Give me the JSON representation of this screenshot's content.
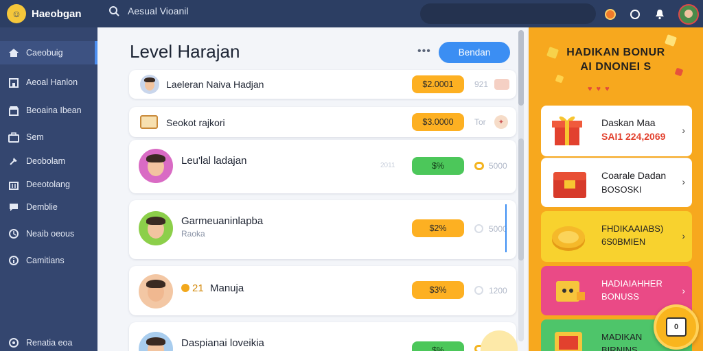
{
  "app": {
    "name": "Haeobgan",
    "search_text": "Aesual Vioanil"
  },
  "sidebar": {
    "items": [
      {
        "label": "Caeobuig",
        "icon": "home-icon"
      },
      {
        "label": "Aeoal Hanlon",
        "icon": "building-icon"
      },
      {
        "label": "Beoaina Ibean",
        "icon": "store-icon"
      },
      {
        "label": "Sem",
        "icon": "briefcase-icon"
      },
      {
        "label": "Deobolam",
        "icon": "pin-icon"
      },
      {
        "label": "Deeotolang",
        "icon": "bank-icon"
      },
      {
        "label": "Demblie",
        "icon": "chat-icon"
      },
      {
        "label": "Neaib oeous",
        "icon": "clock-icon"
      },
      {
        "label": "Camitians",
        "icon": "info-icon"
      },
      {
        "label": "Renatia eoa",
        "icon": "settings-icon"
      }
    ]
  },
  "main": {
    "title": "Level Harajan",
    "more_label": "•••",
    "primary_button": "Bendan",
    "rows": [
      {
        "name": "Laeleran Naiva Hadjan",
        "amount": "$2.0001",
        "side_value": "921",
        "pill": "yellow"
      },
      {
        "name": "Seokot rajkori",
        "amount": "$3.0000",
        "side_value": "Tor",
        "pill": "yellow"
      },
      {
        "name": "Leu'lal ladajan",
        "amount": "$%",
        "side_value": "5000",
        "pill": "green",
        "side_label": "2011"
      },
      {
        "name": "Garmeuaninlapba",
        "subtitle": "Raoka",
        "amount": "$2%",
        "side_value": "5000",
        "pill": "yellow"
      },
      {
        "name": "Manuja",
        "badge": "21",
        "amount": "$3%",
        "side_value": "1200",
        "pill": "yellow"
      },
      {
        "name": "Daspianai loveikia",
        "amount": "$%",
        "pill": "green"
      }
    ]
  },
  "promo_panel": {
    "title_line1": "HADIKAN BONUR",
    "title_line2": "AI DNONEI S",
    "cards": [
      {
        "line1": "Daskan Maa",
        "line2": "SAI1 224,2069"
      },
      {
        "line1": "Coarale Dadan",
        "line2": "BOSOSKI"
      },
      {
        "line1": "FHDIKAAIABS)",
        "line2": "6S0BMIEN"
      },
      {
        "line1": "HADIAIAHHER",
        "line2": "BONUSS"
      },
      {
        "line1": "MADIKAN",
        "line2": "BIRNINS"
      }
    ],
    "fab_label": "0"
  },
  "colors": {
    "topbar": "#2c3e63",
    "sidebar": "#34466f",
    "accent": "#3b8ef3",
    "pill_yellow": "#fdb022",
    "pill_green": "#4cc75a",
    "promo_orange": "#f7a81e"
  }
}
